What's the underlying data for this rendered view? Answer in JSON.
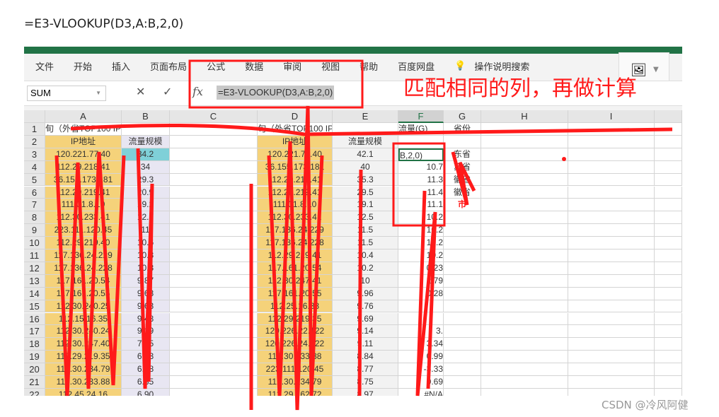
{
  "caption": "=E3-VLOOKUP(D3,A:B,2,0)",
  "menu": [
    "文件",
    "开始",
    "插入",
    "页面布局",
    "公式",
    "数据",
    "审阅",
    "视图",
    "帮助",
    "百度网盘"
  ],
  "tell_me": "操作说明搜索",
  "name_box": "SUM",
  "formula": "=E3-VLOOKUP(D3,A:B,2,0)",
  "annotation": "匹配相同的列，再做计算",
  "watermark": "CSDN @冷风阿健",
  "columns": [
    "A",
    "B",
    "C",
    "D",
    "E",
    "F",
    "G",
    "H",
    "I"
  ],
  "selected_column": "F",
  "rows": [
    [
      "旬（外省TOP100  IP总流量2.3",
      "",
      "",
      "旬（外省TOP100  IP总流量1.78T",
      "",
      "流量(G)",
      "省份"
    ],
    [
      "IP地址",
      "流量规模",
      "",
      "IP地址",
      "流量规模",
      "",
      ""
    ],
    [
      "120.221.77.40",
      "34.2",
      "",
      "120.221.77.40",
      "42.1",
      "B,2,0)",
      "东省"
    ],
    [
      "112.29.218.41",
      "34",
      "",
      "36.155.173.181",
      "40",
      "10.7",
      "苏省"
    ],
    [
      "36.155.173.181",
      "29.3",
      "",
      "112.29.218.41",
      "35.3",
      "11.3",
      "徽省"
    ],
    [
      "112.29.219.41",
      "20.9",
      "",
      "112.29.219.41",
      "29.5",
      "11.4",
      "徽省"
    ],
    [
      "111.31.8.10",
      "19.2",
      "",
      "111.31.8.10",
      "19.1",
      "11.1",
      "市"
    ],
    [
      "112.30.233.41",
      "12.7",
      "",
      "112.30.233.41",
      "12.5",
      "10.2",
      ""
    ],
    [
      "223.111.120.45",
      "11",
      "",
      "117.136.24.229",
      "11.5",
      "10.2",
      ""
    ],
    [
      "112.29.219.40",
      "10.6",
      "",
      "117.136.24.228",
      "11.5",
      "10.2",
      ""
    ],
    [
      "117.136.24.229",
      "10.3",
      "",
      "112.29.219.41",
      "10.4",
      "10.2",
      ""
    ],
    [
      "117.136.24.228",
      "10.3",
      "",
      "117.161.20.54",
      "10.2",
      "0.23",
      ""
    ],
    [
      "117.161.20.54",
      "9.87",
      "",
      "112.30.247.41",
      "10",
      "2.79",
      ""
    ],
    [
      "117.161.20.55",
      "9.68",
      "",
      "117.161.20.55",
      "9.96",
      "0.28",
      ""
    ],
    [
      "112.30.240.25",
      "9.63",
      "",
      "112.25.16.38",
      "9.76",
      "",
      ""
    ],
    [
      "112.15.16.35",
      "9.48",
      "",
      "112.29.219.35",
      "9.69",
      "",
      ""
    ],
    [
      "112.30.240.24",
      "9.19",
      "",
      "120.226.22.122",
      "9.14",
      "3.",
      ""
    ],
    [
      "112.30.247.40",
      "7.75",
      "",
      "120.226.24.122",
      "9.11",
      "3.34",
      ""
    ],
    [
      "112.29.219.35",
      "6.93",
      "",
      "112.30.233.88",
      "8.84",
      "0.99",
      ""
    ],
    [
      "112.30.234.79",
      "6.88",
      "",
      "223.111.120.45",
      "8.77",
      "-3.33",
      ""
    ],
    [
      "112.30.233.88",
      "6.85",
      "",
      "112.30.234.79",
      "8.75",
      "0.69",
      ""
    ],
    [
      "112.45.24.16",
      "6.90",
      "",
      "112.29.162.72",
      "8.97",
      "#N/A",
      ""
    ]
  ],
  "colors": {
    "excel_green": "#217346",
    "ip_fill": "#f5d27a",
    "size_fill": "#e8e6f2",
    "annotation": "#ff1a1a"
  }
}
